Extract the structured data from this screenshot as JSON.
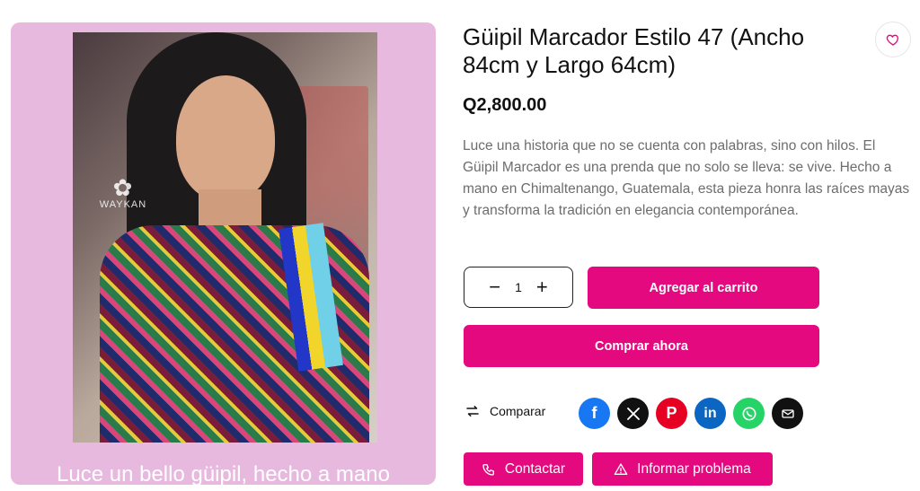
{
  "product": {
    "title": "Güipil Marcador Estilo 47 (Ancho 84cm y Largo 64cm)",
    "price": "Q2,800.00",
    "description": "Luce una historia que no se cuenta con palabras, sino con hilos. El Güipil Marcador es una prenda que no solo se lleva: se vive. Hecho a mano en Chimaltenango, Guatemala, esta pieza honra las raíces mayas y transforma la tradición en elegancia contemporánea."
  },
  "gallery": {
    "watermark": "WAYKAN",
    "caption": "Luce un bello güipil, hecho a mano"
  },
  "quantity": {
    "minus": "−",
    "value": "1",
    "plus": "+"
  },
  "actions": {
    "add_to_cart": "Agregar al carrito",
    "buy_now": "Comprar ahora",
    "compare": "Comparar",
    "contact": "Contactar",
    "report": "Informar problema"
  },
  "share": {
    "icons": [
      "facebook-icon",
      "x-icon",
      "pinterest-icon",
      "linkedin-icon",
      "whatsapp-icon",
      "email-icon"
    ]
  },
  "colors": {
    "accent": "#e5097f",
    "gallery_bg": "#e8b9df"
  }
}
